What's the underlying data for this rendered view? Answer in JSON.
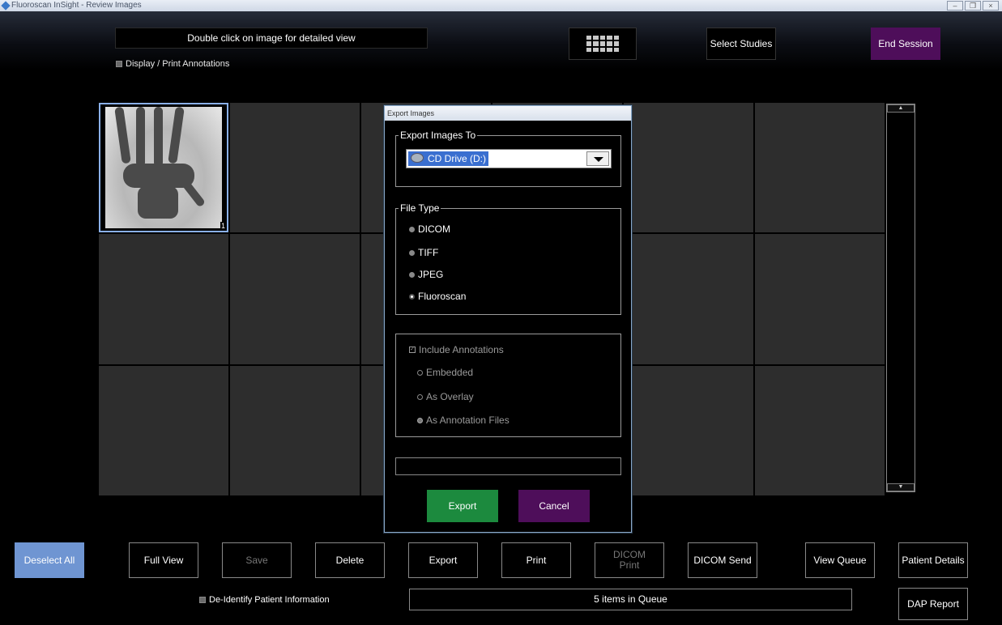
{
  "window": {
    "title": "Fluoroscan InSight - Review Images"
  },
  "header": {
    "instruction": "Double click on image for detailed view",
    "select_studies": "Select Studies",
    "end_session": "End Session",
    "display_print_annotations": "Display / Print Annotations"
  },
  "grid": {
    "selected_image_index": "1"
  },
  "export_dialog": {
    "title": "Export Images",
    "export_to_legend": "Export Images To",
    "drive_selected": "CD Drive (D:)",
    "file_type_legend": "File Type",
    "file_types": [
      "DICOM",
      "TIFF",
      "JPEG",
      "Fluoroscan"
    ],
    "selected_file_type": "Fluoroscan",
    "include_annotations": "Include Annotations",
    "annotation_modes": [
      "Embedded",
      "As Overlay",
      "As Annotation Files"
    ],
    "export_button": "Export",
    "cancel_button": "Cancel"
  },
  "toolbar": {
    "deselect_all": "Deselect All",
    "full_view": "Full View",
    "save": "Save",
    "delete": "Delete",
    "export": "Export",
    "print": "Print",
    "dicom_print_line1": "DICOM",
    "dicom_print_line2": "Print",
    "dicom_send": "DICOM Send",
    "view_queue": "View Queue",
    "patient_details": "Patient Details",
    "dap_report": "DAP Report",
    "deidentify": "De-Identify Patient Information",
    "queue_status": "5 items in Queue"
  },
  "colors": {
    "end_session_bg": "#4e0e5a",
    "export_green": "#1c8a3e",
    "deselect_blue": "#6f95d2"
  }
}
